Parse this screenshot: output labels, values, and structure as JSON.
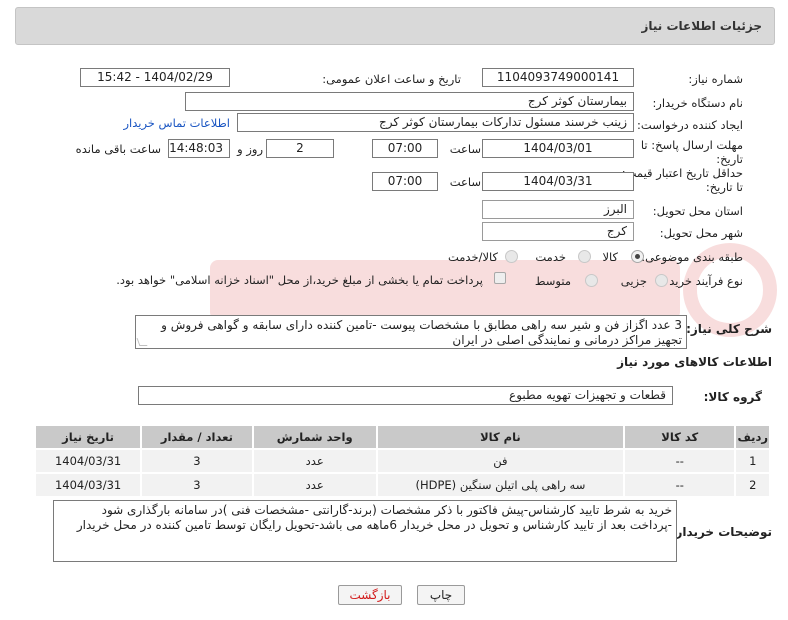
{
  "header": {
    "title": "جزئیات اطلاعات نیاز"
  },
  "fields": {
    "need_number_label": "شماره نیاز:",
    "need_number": "1104093749000141",
    "announce_label": "تاریخ و ساعت اعلان عمومی:",
    "announce_value": "1404/02/29 - 15:42",
    "buyer_org_label": "نام دستگاه خریدار:",
    "buyer_org": "بیمارستان کوثر کرج",
    "creator_label": "ایجاد کننده درخواست:",
    "creator": "زینب خرسند مسئول تدارکات بیمارستان کوثر کرج",
    "contact_link": "اطلاعات تماس خریدار",
    "deadline_label_1": "مهلت ارسال پاسخ: تا",
    "deadline_label_2": "تاریخ:",
    "deadline_date": "1404/03/01",
    "time_label": "ساعت",
    "deadline_time": "07:00",
    "days_value": "2",
    "days_label": "روز و",
    "remaining_time": "14:48:03",
    "remaining_label": "ساعت باقی مانده",
    "validity_label_1": "حداقل تاریخ اعتبار قیمت:",
    "validity_label_2": "تا تاریخ:",
    "validity_date": "1404/03/31",
    "validity_time": "07:00",
    "province_label": "استان محل تحویل:",
    "province": "البرز",
    "city_label": "شهر محل تحویل:",
    "city": "کرج",
    "category_label": "طبقه بندی موضوعی:",
    "category_options": [
      "کالا",
      "خدمت",
      "کالا/خدمت"
    ],
    "process_label": "نوع فرآیند خرید :",
    "process_options": [
      "جزیی",
      "متوسط"
    ],
    "payment_note": "پرداخت تمام یا بخشی از مبلغ خرید،از محل \"اسناد خزانه اسلامی\" خواهد بود."
  },
  "summary": {
    "label": "شرح کلی نیاز:",
    "text": "3 عدد اگزاز فن و شیر سه راهی مطابق با مشخصات پیوست -تامین کننده دارای سابقه و گواهی فروش و تجهیز مراکز درمانی و  نمایندگی اصلی در ایران"
  },
  "goods_section": {
    "title": "اطلاعات کالاهای مورد نیاز",
    "group_label": "گروه کالا:",
    "group_value": "قطعات و تجهیزات تهویه مطبوع"
  },
  "table": {
    "headers": [
      "ردیف",
      "کد کالا",
      "نام کالا",
      "واحد شمارش",
      "تعداد / مقدار",
      "تاریخ نیاز"
    ],
    "rows": [
      [
        "1",
        "--",
        "فن",
        "عدد",
        "3",
        "1404/03/31"
      ],
      [
        "2",
        "--",
        "سه راهی پلی اتیلن سنگین (HDPE)",
        "عدد",
        "3",
        "1404/03/31"
      ]
    ]
  },
  "buyer_notes": {
    "label": "توضیحات خریدار:",
    "text": "خرید به شرط تایید کارشناس-پیش فاکتور با ذکر مشخصات (برند-گارانتی -مشخصات فنی )در سامانه بارگذاری شود -پرداخت بعد از تایید کارشناس و تحویل در محل خریدار 6ماهه می باشد-تحویل رایگان توسط تامین کننده در محل خریدار"
  },
  "buttons": {
    "print": "چاپ",
    "back": "بازگشت"
  },
  "colors": {
    "link": "#1a55c2",
    "back_button_text": "#d21a1a",
    "header_bg": "#d9d9d9",
    "table_header_bg": "#c9c9c9"
  }
}
